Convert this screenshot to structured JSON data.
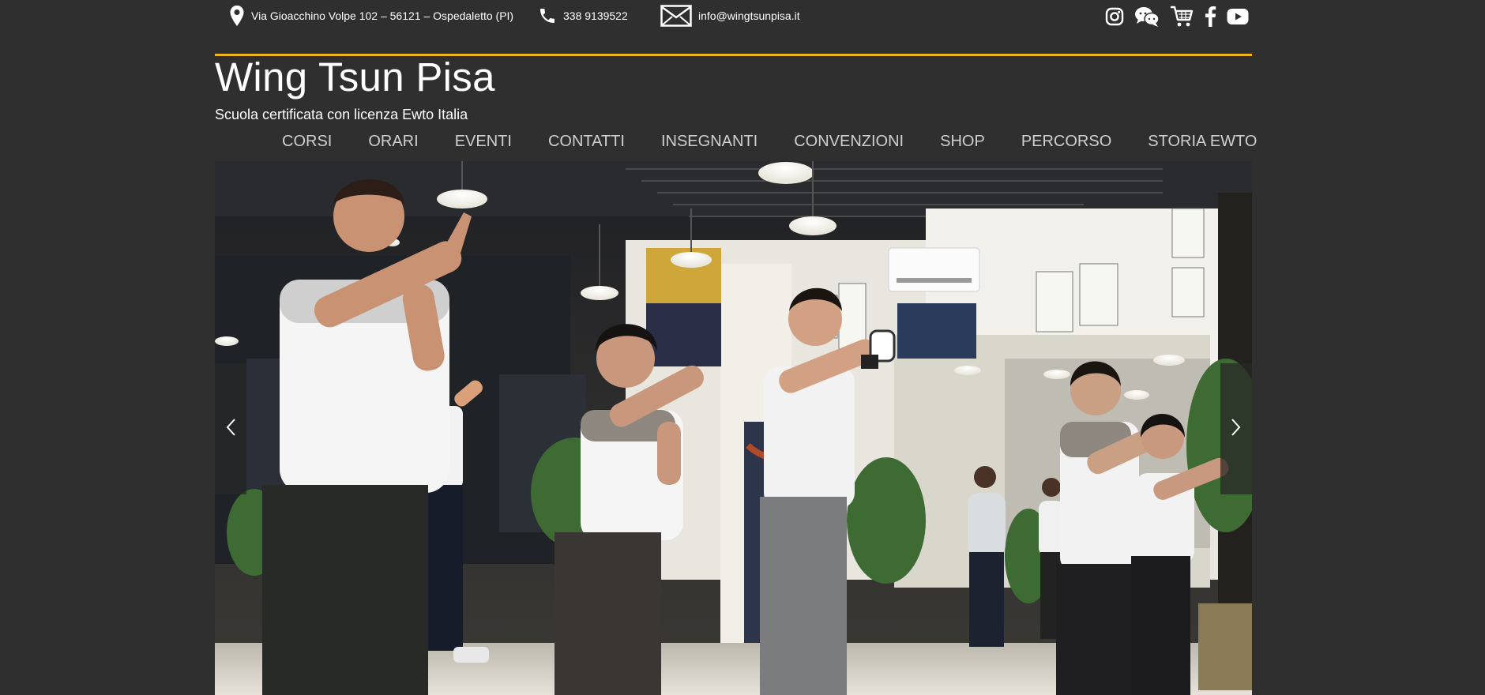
{
  "topbar": {
    "address": "Via Gioacchino Volpe 102 – 56121 – Ospedaletto (PI)",
    "phone": "338 9139522",
    "email": "info@wingtsunpisa.it",
    "icons": {
      "address": "map-pin-icon",
      "phone": "phone-icon",
      "email": "envelope-icon"
    }
  },
  "socials": [
    {
      "name": "instagram",
      "icon": "instagram-icon"
    },
    {
      "name": "chat",
      "icon": "chat-bubbles-icon"
    },
    {
      "name": "shop",
      "icon": "shopping-cart-icon"
    },
    {
      "name": "facebook",
      "icon": "facebook-icon"
    },
    {
      "name": "youtube",
      "icon": "youtube-icon"
    }
  ],
  "brand": {
    "title": "Wing Tsun Pisa",
    "tagline": "Scuola certificata con licenza Ewto Italia"
  },
  "nav": {
    "items": [
      {
        "label": "CORSI"
      },
      {
        "label": "ORARI"
      },
      {
        "label": "EVENTI"
      },
      {
        "label": "CONTATTI"
      },
      {
        "label": "INSEGNANTI"
      },
      {
        "label": "CONVENZIONI"
      },
      {
        "label": "SHOP"
      },
      {
        "label": "PERCORSO"
      },
      {
        "label": "STORIA EWTO"
      }
    ]
  },
  "hero": {
    "prev_icon": "chevron-left-icon",
    "next_icon": "chevron-right-icon"
  },
  "colors": {
    "background": "#2f2f2f",
    "accent_rule": "#f0b323",
    "nav_text": "#cfcfcf",
    "text": "#ffffff"
  }
}
